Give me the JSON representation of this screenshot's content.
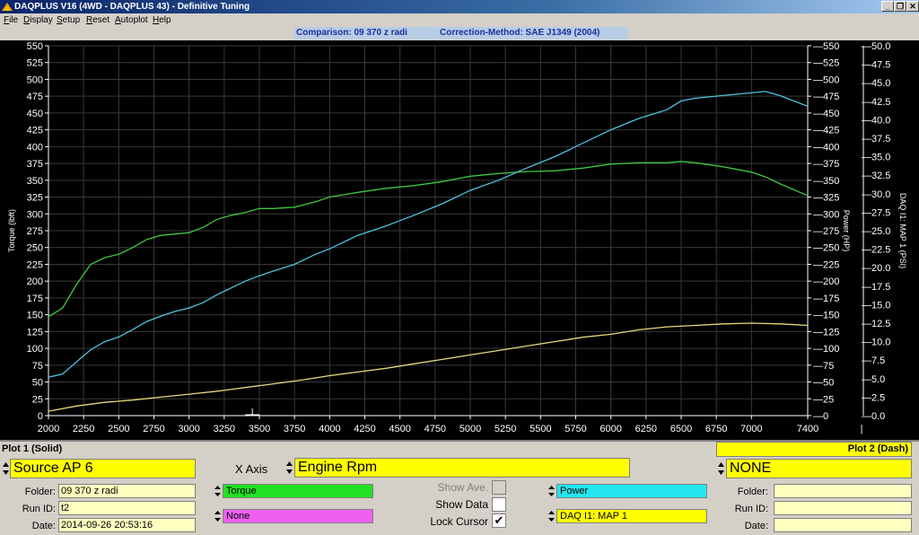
{
  "window": {
    "title": "DAQPLUS V16 (4WD - DAQPLUS 43) - Definitive Tuning",
    "minimize": "_",
    "restore": "❐",
    "close": "✕"
  },
  "menu": [
    "File",
    "Display",
    "Setup",
    "Reset",
    "Autoplot",
    "Help"
  ],
  "info": {
    "comparison": "Comparison: 09 370 z radi",
    "correction": "Correction-Method: SAE J1349 (2004)"
  },
  "colors": {
    "torque": "#3fc63f",
    "power": "#4fc3e0",
    "map": "#e6d87a",
    "yellow": "#ffff00",
    "green": "#22e022",
    "cyan": "#22e6f0",
    "magenta": "#f060f0"
  },
  "chart_data": {
    "type": "line",
    "xlim": [
      2000,
      7400
    ],
    "x_ticks": [
      "2000",
      "2250",
      "2500",
      "2750",
      "3000",
      "3250",
      "3500",
      "3750",
      "4000",
      "4250",
      "4500",
      "4750",
      "5000",
      "5250",
      "5500",
      "5750",
      "6000",
      "6250",
      "6500",
      "6750",
      "7000",
      "7400"
    ],
    "left_axis": {
      "label": "Torque (lbft)",
      "ylim": [
        0,
        550
      ],
      "ticks": [
        "0",
        "25",
        "50",
        "75",
        "100",
        "125",
        "150",
        "175",
        "200",
        "225",
        "250",
        "275",
        "300",
        "325",
        "350",
        "375",
        "400",
        "425",
        "450",
        "475",
        "500",
        "525",
        "550"
      ]
    },
    "mid_axis": {
      "label": "Power (HP)",
      "ylim": [
        0,
        550
      ],
      "ticks": [
        "0",
        "25",
        "50",
        "75",
        "100",
        "125",
        "150",
        "175",
        "200",
        "225",
        "250",
        "275",
        "300",
        "325",
        "350",
        "375",
        "400",
        "425",
        "450",
        "475",
        "500",
        "525",
        "550"
      ]
    },
    "right_axis": {
      "label": "DAQ I1: MAP 1 (PSI)",
      "ylim": [
        0,
        50
      ],
      "ticks": [
        "0.0",
        "2.5",
        "5.0",
        "7.5",
        "10.0",
        "12.5",
        "15.0",
        "17.5",
        "20.0",
        "22.5",
        "25.0",
        "27.5",
        "30.0",
        "32.5",
        "35.0",
        "37.5",
        "40.0",
        "42.5",
        "45.0",
        "47.5",
        "50.0"
      ]
    },
    "grid": true,
    "series": [
      {
        "name": "Torque",
        "axis": "left",
        "color": "#3fc63f",
        "x": [
          2000,
          2100,
          2200,
          2300,
          2400,
          2500,
          2600,
          2700,
          2800,
          3000,
          3100,
          3200,
          3300,
          3400,
          3500,
          3600,
          3750,
          3900,
          4000,
          4200,
          4400,
          4600,
          4800,
          5000,
          5200,
          5400,
          5600,
          5800,
          6000,
          6200,
          6400,
          6500,
          6600,
          6800,
          7000,
          7100,
          7200,
          7400
        ],
        "y": [
          147,
          160,
          195,
          225,
          235,
          240,
          250,
          262,
          268,
          272,
          280,
          292,
          298,
          302,
          308,
          308,
          310,
          318,
          325,
          332,
          338,
          342,
          348,
          356,
          360,
          363,
          364,
          368,
          374,
          376,
          376,
          378,
          376,
          370,
          362,
          355,
          345,
          327
        ]
      },
      {
        "name": "Power",
        "axis": "mid",
        "color": "#4fc3e0",
        "x": [
          2000,
          2100,
          2200,
          2300,
          2400,
          2500,
          2600,
          2700,
          2800,
          2900,
          3000,
          3100,
          3200,
          3300,
          3400,
          3500,
          3600,
          3750,
          3900,
          4000,
          4200,
          4400,
          4600,
          4800,
          5000,
          5200,
          5400,
          5600,
          5800,
          6000,
          6200,
          6400,
          6500,
          6600,
          6800,
          7000,
          7100,
          7200,
          7400
        ],
        "y": [
          57,
          62,
          80,
          98,
          110,
          117,
          128,
          140,
          148,
          155,
          160,
          168,
          180,
          190,
          200,
          208,
          215,
          225,
          240,
          248,
          268,
          282,
          298,
          315,
          335,
          350,
          368,
          385,
          405,
          425,
          442,
          455,
          468,
          472,
          476,
          480,
          482,
          476,
          460
        ]
      },
      {
        "name": "DAQ I1: MAP 1",
        "axis": "right",
        "color": "#e6d87a",
        "x": [
          2000,
          2200,
          2400,
          2600,
          2800,
          3000,
          3200,
          3400,
          3600,
          3800,
          4000,
          4200,
          4400,
          4600,
          4800,
          5000,
          5200,
          5400,
          5600,
          5800,
          6000,
          6200,
          6400,
          6600,
          6800,
          7000,
          7200,
          7400
        ],
        "y": [
          0.6,
          1.3,
          1.8,
          2.1,
          2.5,
          2.9,
          3.3,
          3.8,
          4.3,
          4.8,
          5.4,
          5.9,
          6.4,
          7.0,
          7.6,
          8.2,
          8.8,
          9.4,
          10.0,
          10.6,
          11.0,
          11.6,
          12.0,
          12.2,
          12.4,
          12.5,
          12.4,
          12.2
        ]
      }
    ]
  },
  "panel": {
    "plot1_title": "Plot 1 (Solid)",
    "plot2_title": "Plot 2 (Dash)",
    "source": "Source AP 6",
    "xaxis_label": "X Axis",
    "xaxis_value": "Engine Rpm",
    "plot2_source": "NONE",
    "folder_label": "Folder:",
    "runid_label": "Run ID:",
    "date_label": "Date:",
    "plot1_folder": "09 370 z radi",
    "plot1_runid": "t2",
    "plot1_date": "2014-09-26 20:53:16",
    "plot2_folder": "",
    "plot2_runid": "",
    "plot2_date": "",
    "channel_torque": "Torque",
    "channel_none": "None",
    "channel_power": "Power",
    "channel_map": "DAQ I1: MAP 1",
    "show_ave_label": "Show Ave.",
    "show_data_label": "Show Data",
    "lock_cursor_label": "Lock Cursor",
    "lock_cursor_check": "✔"
  }
}
